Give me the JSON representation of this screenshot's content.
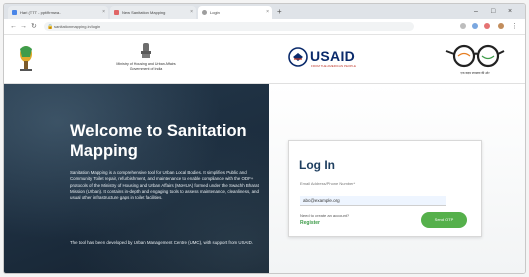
{
  "browser": {
    "tabs": [
      {
        "label": "Hari (TTT - ppt/firmwa.."
      },
      {
        "label": "New Sanitation Mapping"
      },
      {
        "label": "Login"
      }
    ],
    "new_tab_glyph": "+",
    "url": "sanitationmapping.in/login",
    "window_controls": [
      "–",
      "□",
      "×"
    ]
  },
  "header": {
    "ministry_text": "Ministry of Housing and Urban Affairs Government of India",
    "usaid_logo": "USAID",
    "usaid_tagline": "FROM THE AMERICAN PEOPLE",
    "swachh_caption": "एक कदम स्वच्छता की ओर"
  },
  "hero": {
    "title": "Welcome to Sanitation Mapping",
    "description": "Sanitation Mapping is a comprehensive tool for Urban Local Bodies. It simplifies Public and Community Toilet repair, refurbishment, and maintenance to enable compliance with the ODF+ protocols of the Ministry of Housing and Urban Affairs (MoHUA) formed under the Swachh Bharat Mission (Urban). It contains in-depth and engaging tools to assess maintenance, cleanliness, and usual other infrastructure gaps in toilet facilities.",
    "credit": "The tool has been developed by Urban Management Centre (UMC), with support from USAID."
  },
  "login": {
    "title": "Log In",
    "field_label": "Email Address/Phone Number*",
    "field_value": "abc@example.org",
    "register_question": "Need to create an account?",
    "register_link": "Register",
    "submit_label": "Send OTP"
  },
  "icons": {
    "tab1": "file-icon",
    "tab2": "page-icon",
    "tab3": "globe-icon",
    "back": "back-arrow-icon",
    "forward": "forward-arrow-icon",
    "reload": "reload-icon",
    "lock": "lock-icon",
    "emblem_left": "state-emblem-icon",
    "emblem_center": "national-emblem-icon",
    "usaid": "usaid-seal-icon",
    "swachh": "swachh-bharat-glasses-icon"
  },
  "colors": {
    "brand_green": "#55b04b",
    "hero_bg": "#1c2d3e",
    "title_blue": "#1f3f60",
    "usaid_navy": "#0a2a6b",
    "usaid_red": "#c0392b"
  }
}
